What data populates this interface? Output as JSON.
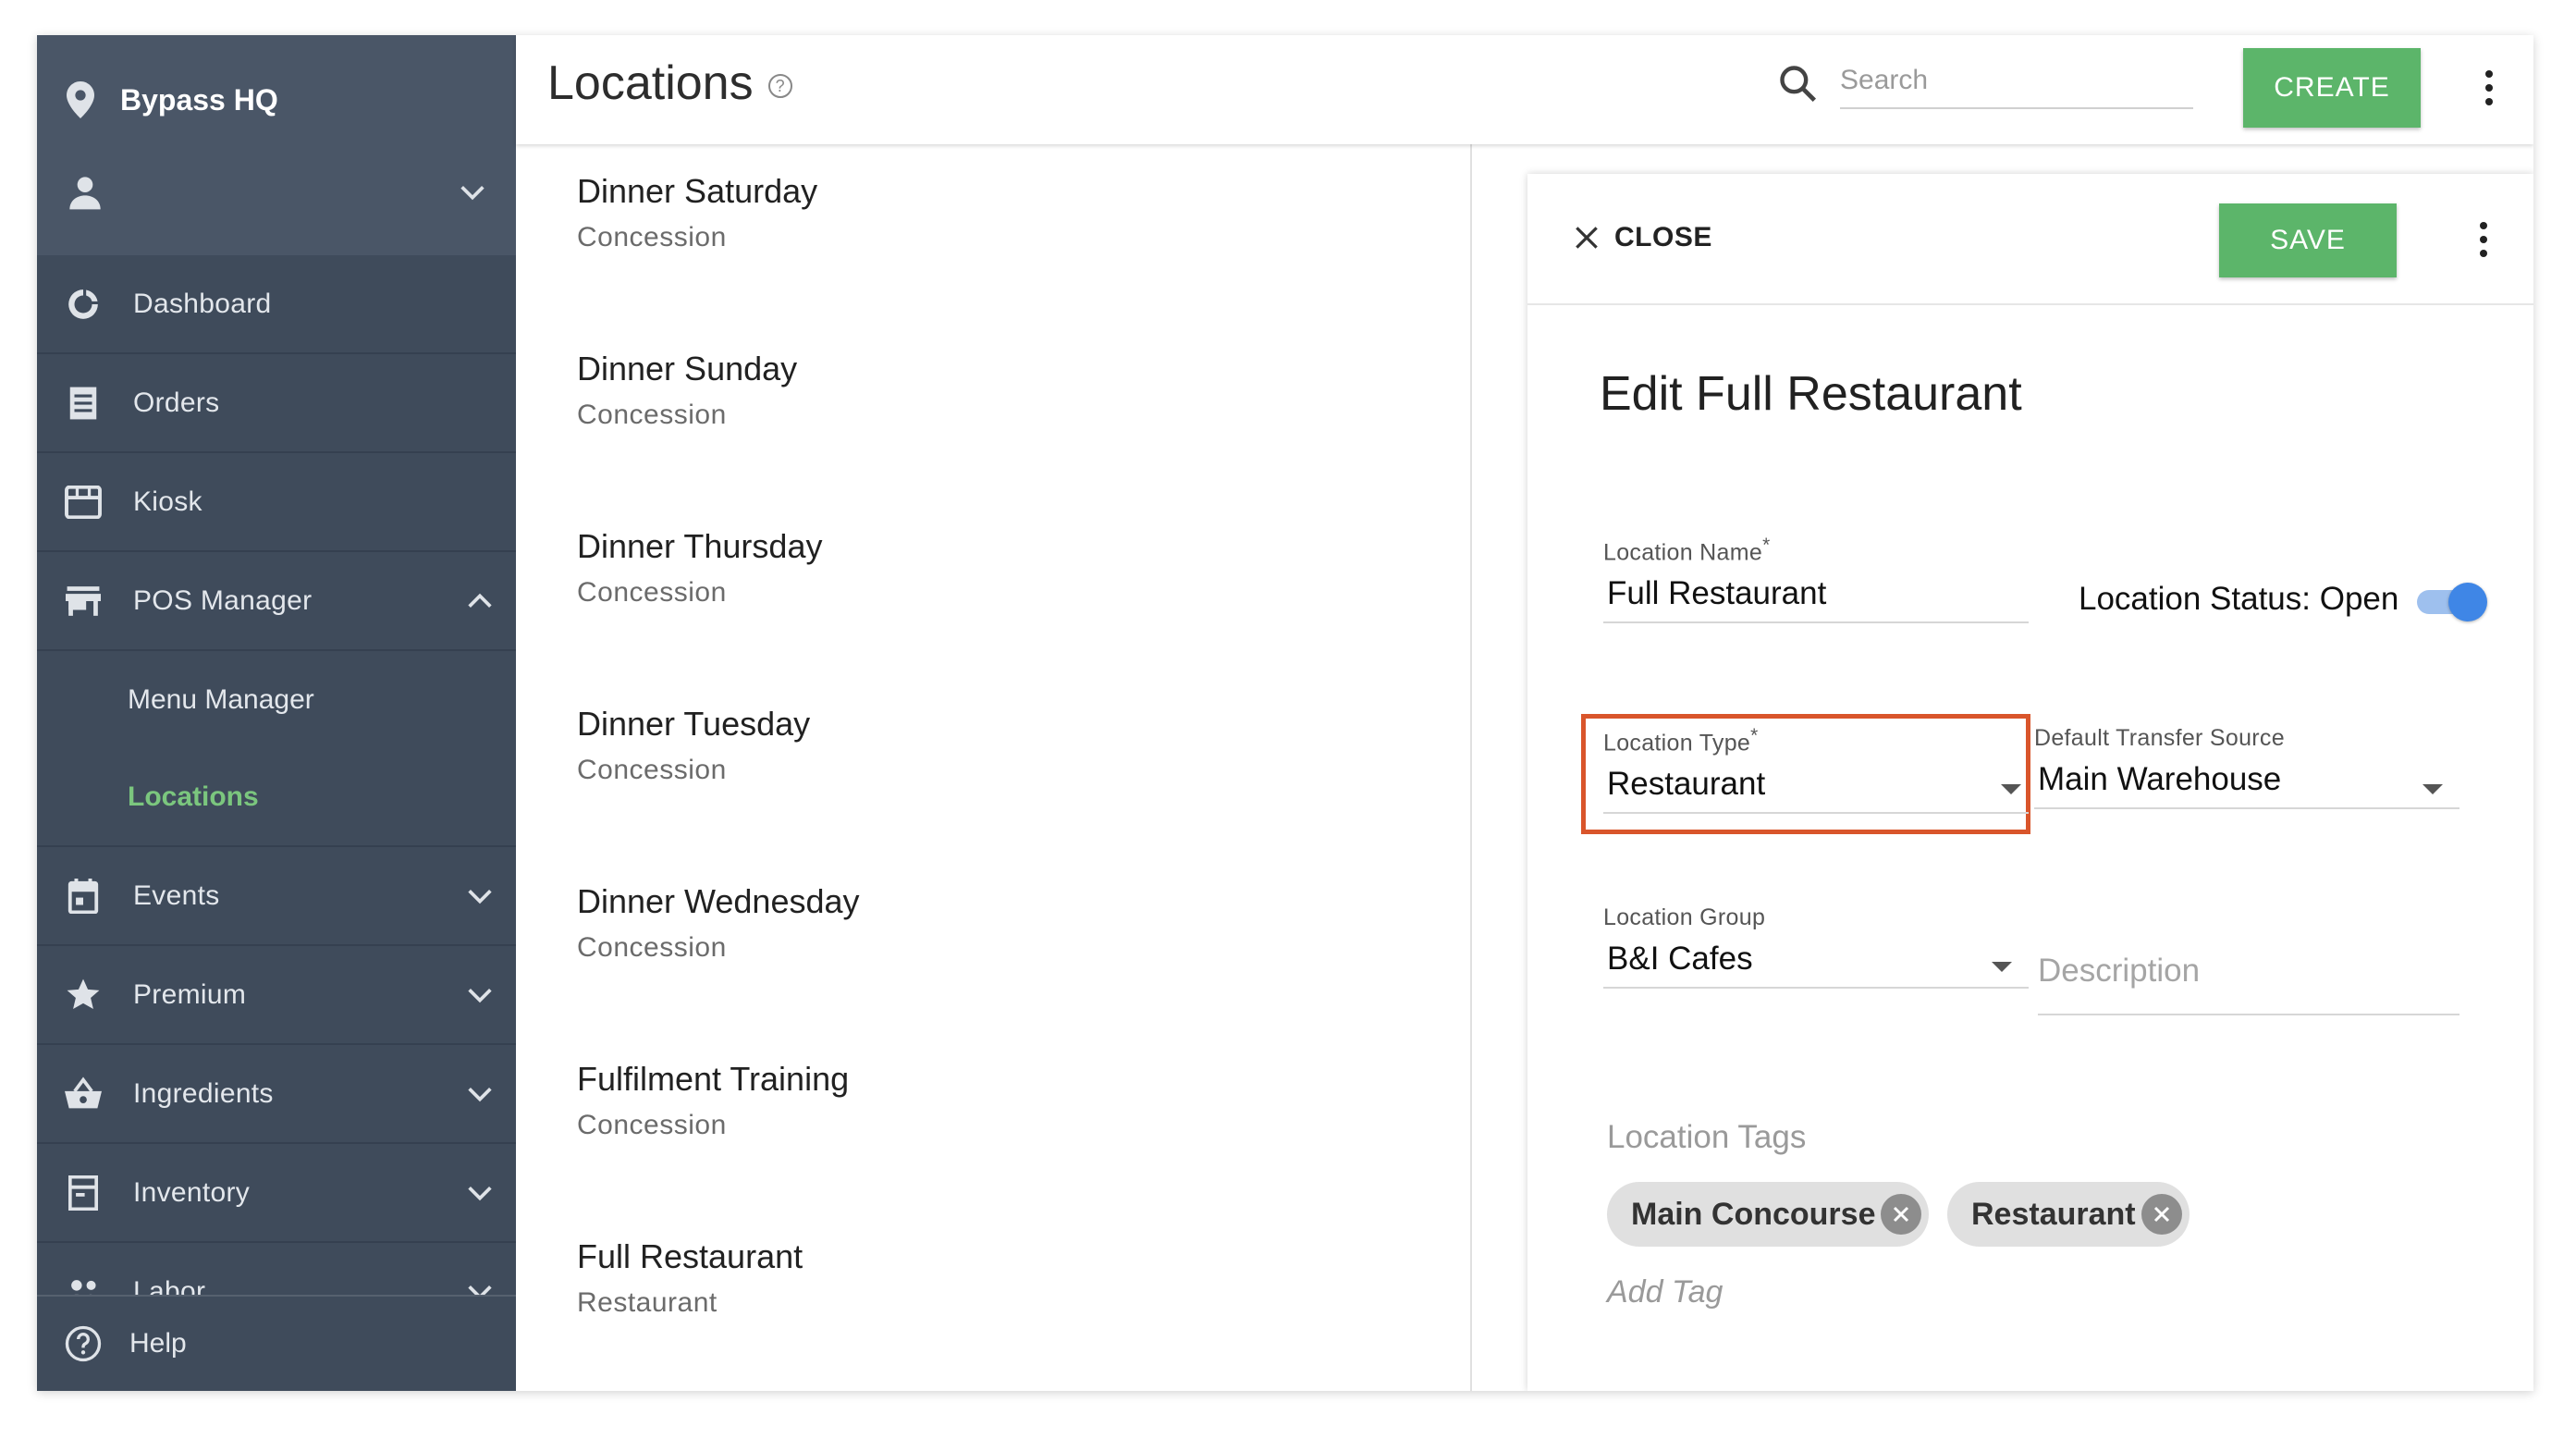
{
  "sidebar": {
    "venue_name": "Bypass HQ",
    "items": [
      {
        "label": "Dashboard",
        "icon": "dashboard-icon"
      },
      {
        "label": "Orders",
        "icon": "orders-icon"
      },
      {
        "label": "Kiosk",
        "icon": "kiosk-icon"
      },
      {
        "label": "POS Manager",
        "icon": "store-icon"
      },
      {
        "label": "Events",
        "icon": "calendar-icon"
      },
      {
        "label": "Premium",
        "icon": "star-icon"
      },
      {
        "label": "Ingredients",
        "icon": "basket-icon"
      },
      {
        "label": "Inventory",
        "icon": "inventory-icon"
      },
      {
        "label": "Labor",
        "icon": "people-icon"
      }
    ],
    "sub_items": [
      {
        "label": "Menu Manager",
        "active": false
      },
      {
        "label": "Locations",
        "active": true
      }
    ],
    "help_label": "Help"
  },
  "header": {
    "title": "Locations",
    "help_mark": "?",
    "search_placeholder": "Search",
    "create_label": "CREATE"
  },
  "locations": [
    {
      "name": "Dinner Saturday",
      "type": "Concession"
    },
    {
      "name": "Dinner Sunday",
      "type": "Concession"
    },
    {
      "name": "Dinner Thursday",
      "type": "Concession"
    },
    {
      "name": "Dinner Tuesday",
      "type": "Concession"
    },
    {
      "name": "Dinner Wednesday",
      "type": "Concession"
    },
    {
      "name": "Fulfilment Training",
      "type": "Concession"
    },
    {
      "name": "Full Restaurant",
      "type": "Restaurant"
    }
  ],
  "edit": {
    "close_label": "CLOSE",
    "save_label": "SAVE",
    "title": "Edit Full Restaurant",
    "location_name_label": "Location Name",
    "location_name_value": "Full Restaurant",
    "status_label": "Location Status: Open",
    "status_on": true,
    "location_type_label": "Location Type",
    "location_type_value": "Restaurant",
    "transfer_label": "Default Transfer Source",
    "transfer_value": "Main Warehouse",
    "group_label": "Location Group",
    "group_value": "B&I Cafes",
    "description_placeholder": "Description",
    "tags_label": "Location Tags",
    "tags": [
      "Main Concourse",
      "Restaurant"
    ],
    "add_tag_placeholder": "Add Tag",
    "required_mark": "*"
  },
  "colors": {
    "sidebar_bg": "#3f4b5b",
    "sidebar_top_bg": "#4a5667",
    "active_green": "#7bc67e",
    "button_green": "#5cb56a",
    "toggle_blue": "#3f86e6",
    "highlight_orange": "#d9552b"
  }
}
